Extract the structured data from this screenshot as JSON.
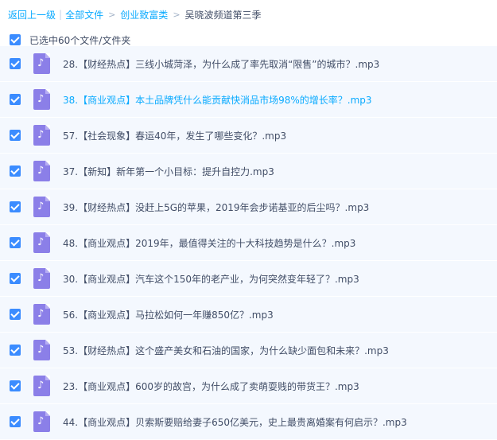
{
  "breadcrumb": {
    "back": "返回上一级",
    "separator": "|",
    "all_files": "全部文件",
    "folder": "创业致富类",
    "current": "吴晓波频道第三季",
    "arrow": ">"
  },
  "selection": {
    "label": "已选中60个文件/文件夹",
    "checked": true
  },
  "colors": {
    "accent": "#09aaff",
    "checkbox": "#3b8cff",
    "row_bg": "#f4f8fe",
    "audio_icon": "#8b7fe8"
  },
  "files": [
    {
      "name": "28.【财经热点】三线小城菏泽，为什么成了率先取消“限售”的城市？.mp3",
      "checked": true,
      "icon": "music-file-icon",
      "highlighted": false
    },
    {
      "name": "38.【商业观点】本土品牌凭什么能贡献快消品市场98%的增长率？.mp3",
      "checked": true,
      "icon": "music-file-icon",
      "highlighted": true
    },
    {
      "name": "57.【社会现象】春运40年，发生了哪些变化？.mp3",
      "checked": true,
      "icon": "music-file-icon",
      "highlighted": false
    },
    {
      "name": "37.【新知】新年第一个小目标：提升自控力.mp3",
      "checked": true,
      "icon": "music-file-icon",
      "highlighted": false
    },
    {
      "name": "39.【财经热点】没赶上5G的苹果，2019年会步诺基亚的后尘吗？.mp3",
      "checked": true,
      "icon": "music-file-icon",
      "highlighted": false
    },
    {
      "name": "48.【商业观点】2019年，最值得关注的十大科技趋势是什么？.mp3",
      "checked": true,
      "icon": "music-file-icon",
      "highlighted": false
    },
    {
      "name": "30.【商业观点】汽车这个150年的老产业，为何突然变年轻了？.mp3",
      "checked": true,
      "icon": "music-file-icon",
      "highlighted": false
    },
    {
      "name": "56.【商业观点】马拉松如何一年赚850亿？.mp3",
      "checked": true,
      "icon": "music-file-icon",
      "highlighted": false
    },
    {
      "name": "53.【财经热点】这个盛产美女和石油的国家，为什么缺少面包和未来？.mp3",
      "checked": true,
      "icon": "music-file-icon",
      "highlighted": false
    },
    {
      "name": "23.【商业观点】600岁的故宫，为什么成了卖萌耍贱的带货王？.mp3",
      "checked": true,
      "icon": "music-file-icon",
      "highlighted": false
    },
    {
      "name": "44.【商业观点】贝索斯要赔给妻子650亿美元，史上最贵离婚案有何启示？.mp3",
      "checked": true,
      "icon": "music-file-icon",
      "highlighted": false
    }
  ]
}
